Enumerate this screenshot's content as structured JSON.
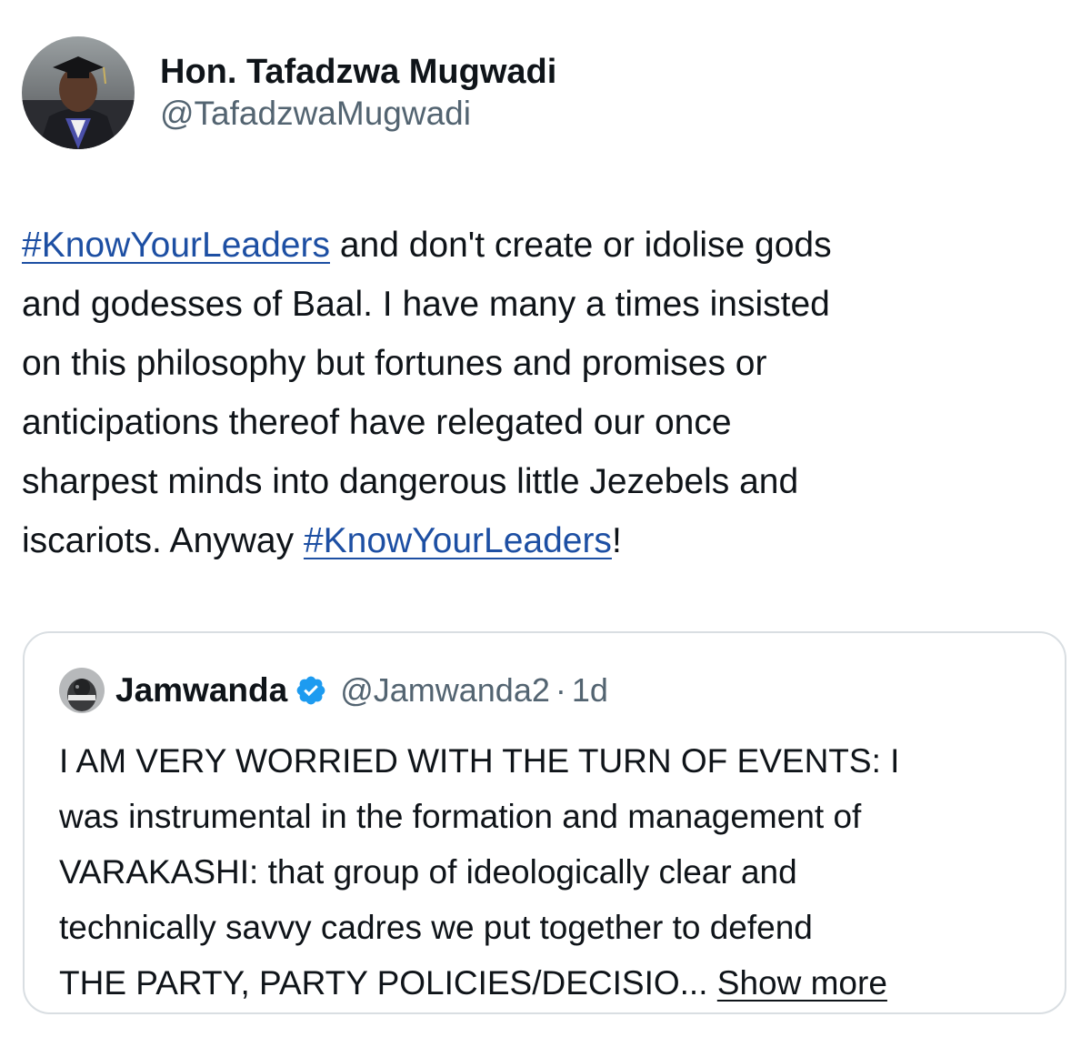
{
  "author": {
    "display_name": "Hon. Tafadzwa Mugwadi",
    "handle": "@TafadzwaMugwadi"
  },
  "tweet": {
    "lines": [
      [
        {
          "type": "hashtag",
          "text": "#KnowYourLeaders"
        },
        {
          "type": "text",
          "text": " and don't create or idolise gods"
        }
      ],
      [
        {
          "type": "text",
          "text": "and godesses of Baal. I have many a times insisted"
        }
      ],
      [
        {
          "type": "text",
          "text": "on this philosophy but fortunes and promises or"
        }
      ],
      [
        {
          "type": "text",
          "text": "anticipations thereof have relegated our once"
        }
      ],
      [
        {
          "type": "text",
          "text": "sharpest minds into dangerous little Jezebels and"
        }
      ],
      [
        {
          "type": "text",
          "text": "iscariots. Anyway "
        },
        {
          "type": "hashtag",
          "text": "#KnowYourLeaders"
        },
        {
          "type": "text",
          "text": "!"
        }
      ]
    ]
  },
  "quote": {
    "display_name": "Jamwanda",
    "handle": "@Jamwanda2",
    "separator": "·",
    "time": "1d",
    "lines": [
      "I AM VERY WORRIED WITH THE TURN OF EVENTS: I",
      "was instrumental in the formation and management of",
      "VARAKASHI: that group of ideologically clear and",
      "technically savvy cadres we put together to defend",
      "THE PARTY, PARTY POLICIES/DECISIO... "
    ],
    "show_more": "Show more"
  },
  "colors": {
    "hashtag": "#1d4fa3",
    "handle_gray": "#536471",
    "verified_blue": "#1d9bf0",
    "border": "#d9dee2"
  },
  "icons": {
    "verified": "verified-badge-icon"
  }
}
